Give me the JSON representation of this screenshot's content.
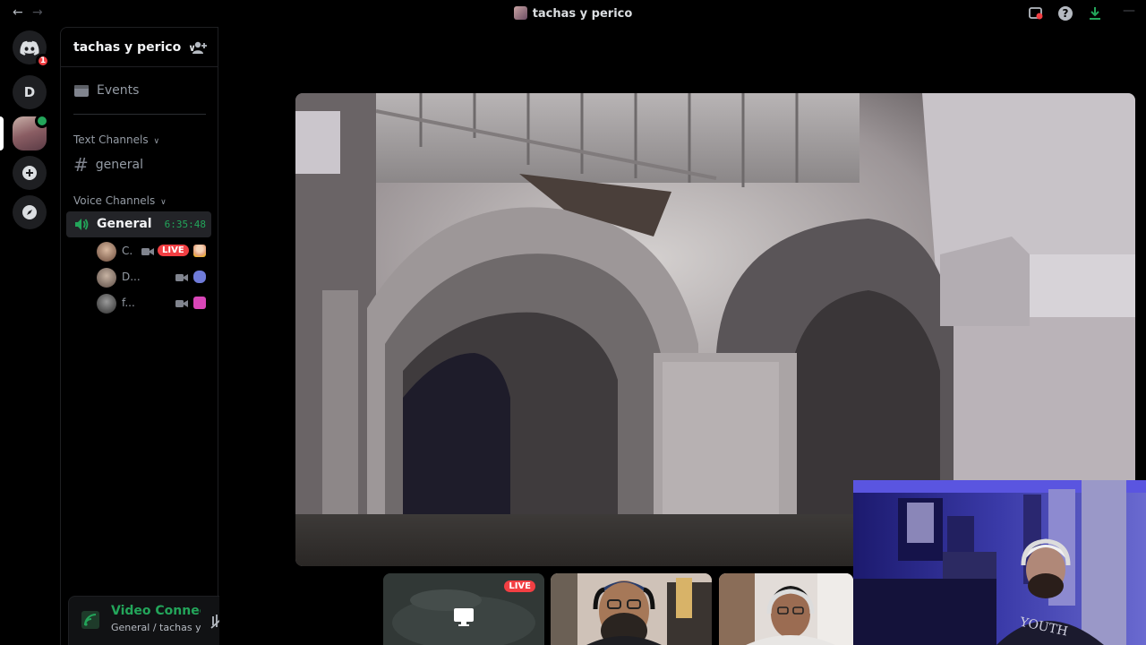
{
  "window": {
    "title": "tachas y perico"
  },
  "rail": {
    "dm_badge": "1",
    "server_letter": "D"
  },
  "sidebar": {
    "server_name": "tachas y perico",
    "events_label": "Events",
    "text_category": "Text Channels",
    "text_channel": "general",
    "voice_category": "Voice Channels",
    "voice_channel": {
      "name": "General",
      "timer": "6:35:48",
      "users": [
        {
          "name": "C.",
          "live": true,
          "live_label": "LIVE"
        },
        {
          "name": "D...",
          "live": false
        },
        {
          "name": "f...",
          "live": false
        }
      ]
    }
  },
  "voice_panel": {
    "status": "Video Connected",
    "sub": "General / tachas y perico"
  },
  "stage": {
    "thumb_live_label": "LIVE"
  },
  "colors": {
    "accent_green": "#23a55a",
    "live_red": "#f23f43",
    "blurple": "#5865f2"
  }
}
